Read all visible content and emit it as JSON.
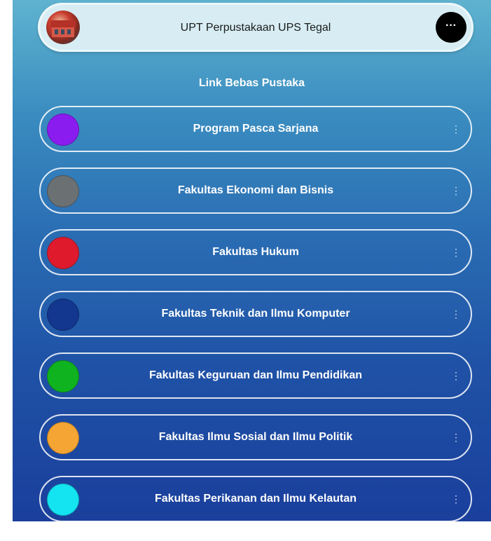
{
  "profile": {
    "title": "UPT Perpustakaan UPS Tegal",
    "more_label": "···"
  },
  "section": {
    "title": "Link Bebas Pustaka"
  },
  "links": [
    {
      "label": "Program Pasca Sarjana",
      "color": "#8b1cf0"
    },
    {
      "label": "Fakultas Ekonomi dan Bisnis",
      "color": "#6b7073"
    },
    {
      "label": "Fakultas Hukum",
      "color": "#de1a2c"
    },
    {
      "label": "Fakultas Teknik dan Ilmu Komputer",
      "color": "#13378f"
    },
    {
      "label": "Fakultas Keguruan dan Ilmu Pendidikan",
      "color": "#0fb31f"
    },
    {
      "label": "Fakultas Ilmu Sosial dan Ilmu Politik",
      "color": "#f5a534"
    },
    {
      "label": "Fakultas Perikanan dan Ilmu Kelautan",
      "color": "#14e4f2"
    }
  ],
  "kebab_label": "⋮"
}
